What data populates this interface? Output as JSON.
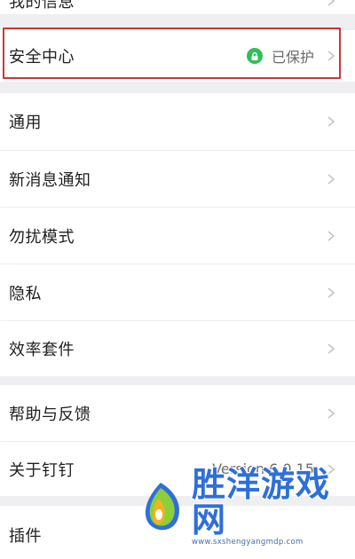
{
  "settings": {
    "my_info": "我的信息",
    "security_center": "安全中心",
    "security_status": "已保护",
    "general": "通用",
    "new_message_notifications": "新消息通知",
    "do_not_disturb": "勿扰模式",
    "privacy": "隐私",
    "productivity_suite": "效率套件",
    "help_feedback": "帮助与反馈",
    "about": "关于钉钉",
    "version": "Version 6.0.15",
    "plugins": "插件"
  },
  "watermark": {
    "title": "胜洋游戏网",
    "url": "www.sxshengyangmdp.com"
  },
  "colors": {
    "highlight_border": "#c8383a",
    "protected_badge": "#2fbf58",
    "watermark_blue": "#2e6fd9"
  },
  "icons": [
    "chevron-right-icon",
    "shield-lock-icon"
  ]
}
